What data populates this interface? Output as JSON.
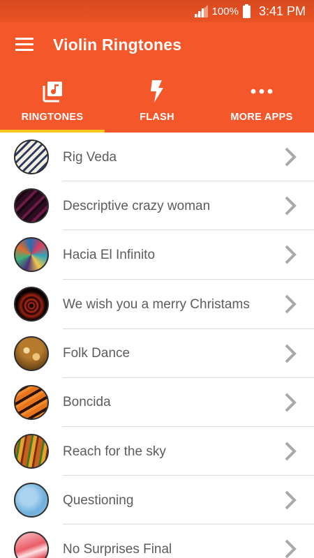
{
  "status_bar": {
    "battery_percent": "100%",
    "time": "3:41 PM",
    "icons": [
      "signal-icon",
      "battery-icon"
    ]
  },
  "app_bar": {
    "title": "Violin Ringtones",
    "menu_icon": "hamburger-menu-icon"
  },
  "tabs": [
    {
      "label": "RINGTONES",
      "icon": "music-library-icon",
      "selected": true
    },
    {
      "label": "FLASH",
      "icon": "flash-icon",
      "selected": false
    },
    {
      "label": "MORE APPS",
      "icon": "more-horizontal-icon",
      "selected": false
    }
  ],
  "colors": {
    "primary": "#f4572a",
    "status_bar": "#e04f22",
    "tab_indicator": "#ffc81e",
    "item_text": "#5c5c5c",
    "chevron": "#a8a8a8"
  },
  "ringtones": [
    {
      "title": "Rig Veda"
    },
    {
      "title": "Descriptive crazy woman"
    },
    {
      "title": "Hacia El Infinito"
    },
    {
      "title": "We wish you a merry Christams"
    },
    {
      "title": "Folk Dance"
    },
    {
      "title": "Boncida"
    },
    {
      "title": "Reach for the sky"
    },
    {
      "title": "Questioning"
    },
    {
      "title": "No Surprises Final"
    }
  ]
}
